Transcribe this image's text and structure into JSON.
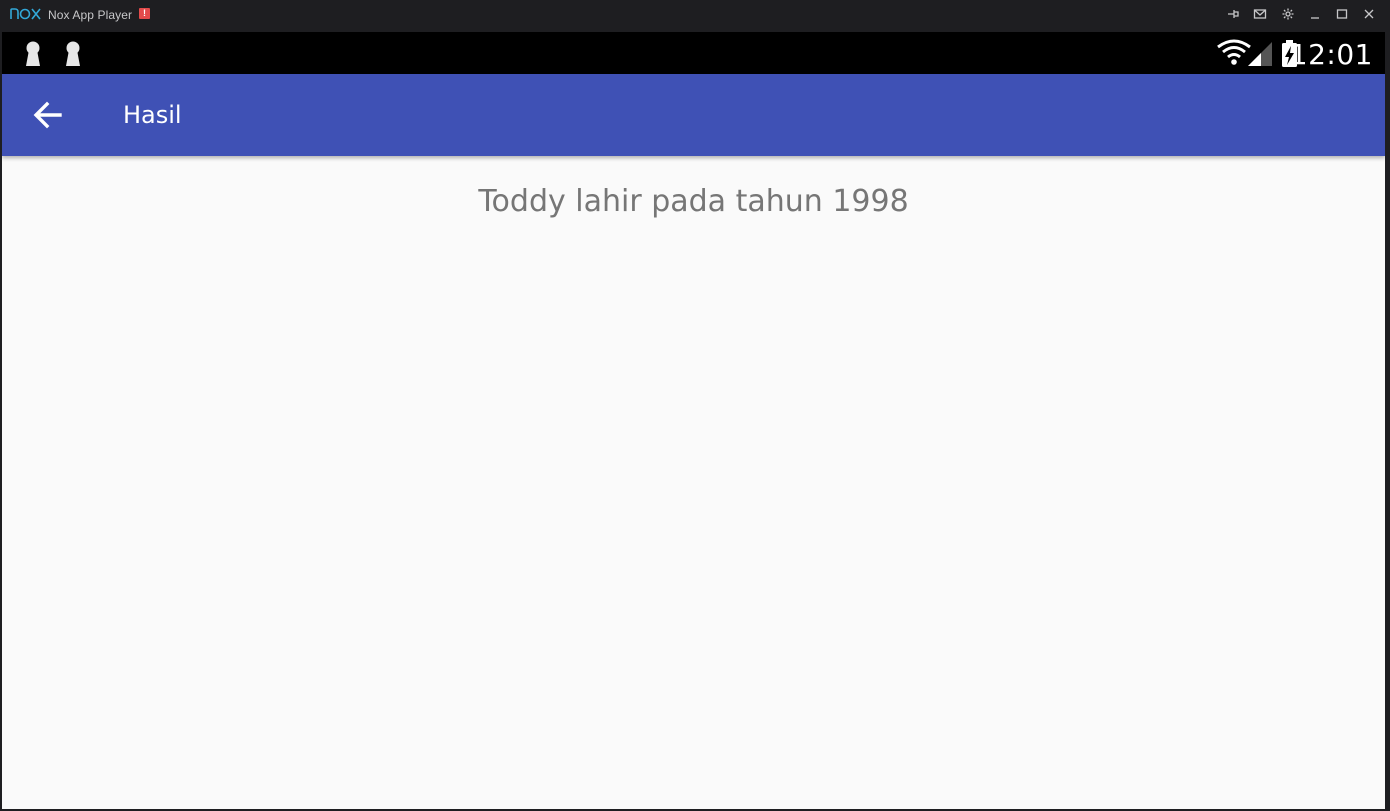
{
  "window": {
    "title": "Nox App Player",
    "alert_badge": "!",
    "controls": [
      "pin-icon",
      "mail-icon",
      "gear-icon",
      "minimize-icon",
      "maximize-icon",
      "close-icon"
    ]
  },
  "statusbar": {
    "notifications": [
      "keyhole-icon",
      "keyhole-icon"
    ],
    "icons": [
      "wifi-icon",
      "signal-icon",
      "battery-charging-icon"
    ],
    "time": "12:01"
  },
  "appbar": {
    "back_icon": "arrow-back-icon",
    "title": "Hasil"
  },
  "content": {
    "result": "Toddy lahir pada tahun 1998"
  },
  "colors": {
    "appbar": "#3f51b5",
    "background": "#fafafa",
    "result_text": "#767676",
    "window_chrome": "#1e1e21",
    "logo": "#32a8d8",
    "alert": "#e34b4b"
  }
}
